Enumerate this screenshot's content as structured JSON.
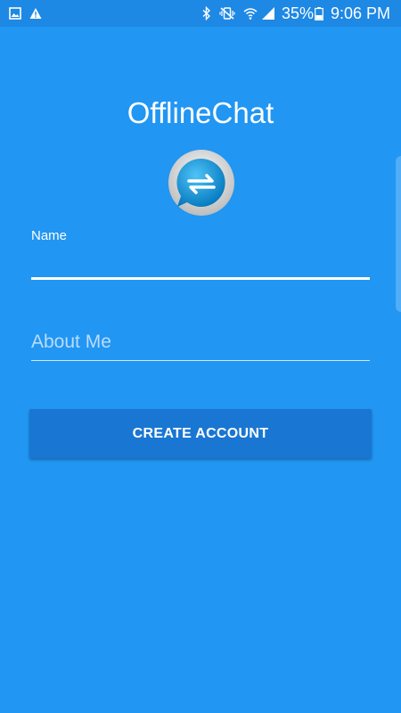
{
  "status_bar": {
    "battery_percent": "35%",
    "time": "9:06 PM",
    "left_icons": [
      "gallery-icon",
      "warning-icon"
    ],
    "right_icons": [
      "bluetooth-icon",
      "vibrate-mute-icon",
      "wifi-icon",
      "signal-icon",
      "battery-icon"
    ]
  },
  "app": {
    "title": "OfflineChat",
    "logo_icon": "chat-bubble-arrows-icon"
  },
  "form": {
    "name_label": "Name",
    "name_value": "",
    "about_placeholder": "About Me",
    "about_value": "",
    "create_button_label": "CREATE ACCOUNT"
  },
  "colors": {
    "background": "#2196f3",
    "status_bar": "#1e88e5",
    "button": "#1976d2",
    "text": "#ffffff"
  }
}
